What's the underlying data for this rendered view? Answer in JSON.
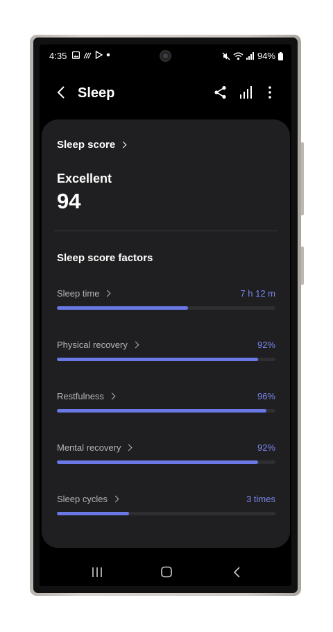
{
  "status_bar": {
    "time": "4:35",
    "battery": "94%",
    "icons": [
      "image-icon",
      "wifi-calling-icon",
      "play-store-icon",
      "notification-dot-icon",
      "mute-icon",
      "wifi-icon",
      "signal-icon",
      "battery-icon"
    ]
  },
  "header": {
    "title": "Sleep",
    "actions": [
      "share-icon",
      "chart-icon",
      "more-icon"
    ]
  },
  "sleep_score": {
    "link_label": "Sleep score",
    "rating": "Excellent",
    "score": "94"
  },
  "factors": {
    "title": "Sleep score factors",
    "items": [
      {
        "label": "Sleep time",
        "value": "7 h 12 m",
        "progress": 0.6
      },
      {
        "label": "Physical recovery",
        "value": "92%",
        "progress": 0.92
      },
      {
        "label": "Restfulness",
        "value": "96%",
        "progress": 0.96
      },
      {
        "label": "Mental recovery",
        "value": "92%",
        "progress": 0.92
      },
      {
        "label": "Sleep cycles",
        "value": "3 times",
        "progress": 0.33
      }
    ]
  },
  "colors": {
    "accent": "#6a78e6",
    "accent_text": "#7b87ee",
    "card": "#1f1f21",
    "screen": "#000000"
  },
  "nav_bar": [
    "recents-icon",
    "home-icon",
    "back-icon"
  ]
}
